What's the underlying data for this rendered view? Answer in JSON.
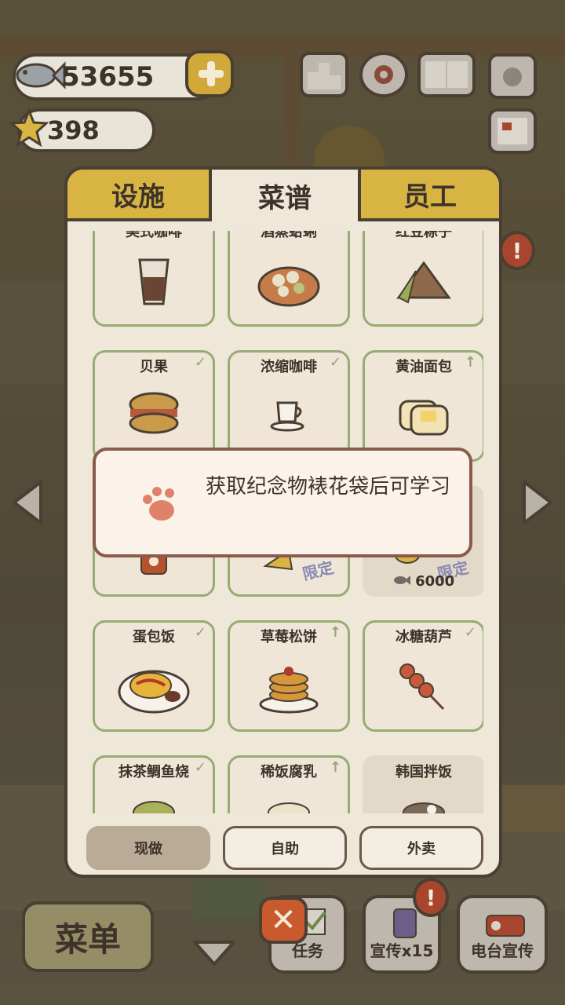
{
  "hud": {
    "fish_count": "53655",
    "star_count": "398"
  },
  "tabs": [
    "设施",
    "菜谱",
    "员工"
  ],
  "recipes": [
    {
      "name": "美式咖啡",
      "mark": "",
      "icon": "iced-coffee-icon"
    },
    {
      "name": "酒蒸蛤蜊",
      "mark": "",
      "icon": "steamed-clams-icon"
    },
    {
      "name": "红豆粽子",
      "mark": "",
      "icon": "zongzi-icon"
    },
    {
      "name": "贝果",
      "mark": "✓",
      "icon": "bagel-icon"
    },
    {
      "name": "浓缩咖啡",
      "mark": "✓",
      "icon": "espresso-icon"
    },
    {
      "name": "黄油面包",
      "mark": "↑",
      "icon": "butter-bread-icon"
    },
    {
      "name": "",
      "mark": "",
      "icon": "cat-jar-icon"
    },
    {
      "name": "",
      "mark": "",
      "icon": "chips-icon",
      "limited": "限定"
    },
    {
      "name": "",
      "mark": "",
      "icon": "mooncake-icon",
      "limited": "限定",
      "price": "6000"
    },
    {
      "name": "蛋包饭",
      "mark": "✓",
      "icon": "omurice-icon"
    },
    {
      "name": "草莓松饼",
      "mark": "↑",
      "icon": "pancake-icon"
    },
    {
      "name": "冰糖葫芦",
      "mark": "✓",
      "icon": "tanghulu-icon"
    },
    {
      "name": "抹茶鲷鱼烧",
      "mark": "✓",
      "icon": "taiyaki-icon"
    },
    {
      "name": "稀饭腐乳",
      "mark": "↑",
      "icon": "porridge-icon"
    },
    {
      "name": "韩国拌饭",
      "mark": "",
      "icon": "bibimbap-icon"
    }
  ],
  "filters": [
    "现做",
    "自助",
    "外卖"
  ],
  "popup": {
    "message": "获取纪念物裱花袋后可学习",
    "icon": "paw-icon"
  },
  "bottom": {
    "menu_label": "菜单",
    "close_label": "✕",
    "task_label": "任务",
    "promo_label": "宣传x15",
    "radio_label": "电台宣传",
    "alert": "!"
  },
  "colors": {
    "accent_yellow": "#d8b543",
    "card_border": "#95ad75",
    "paw": "#e0826a",
    "close": "#c95a2e"
  }
}
